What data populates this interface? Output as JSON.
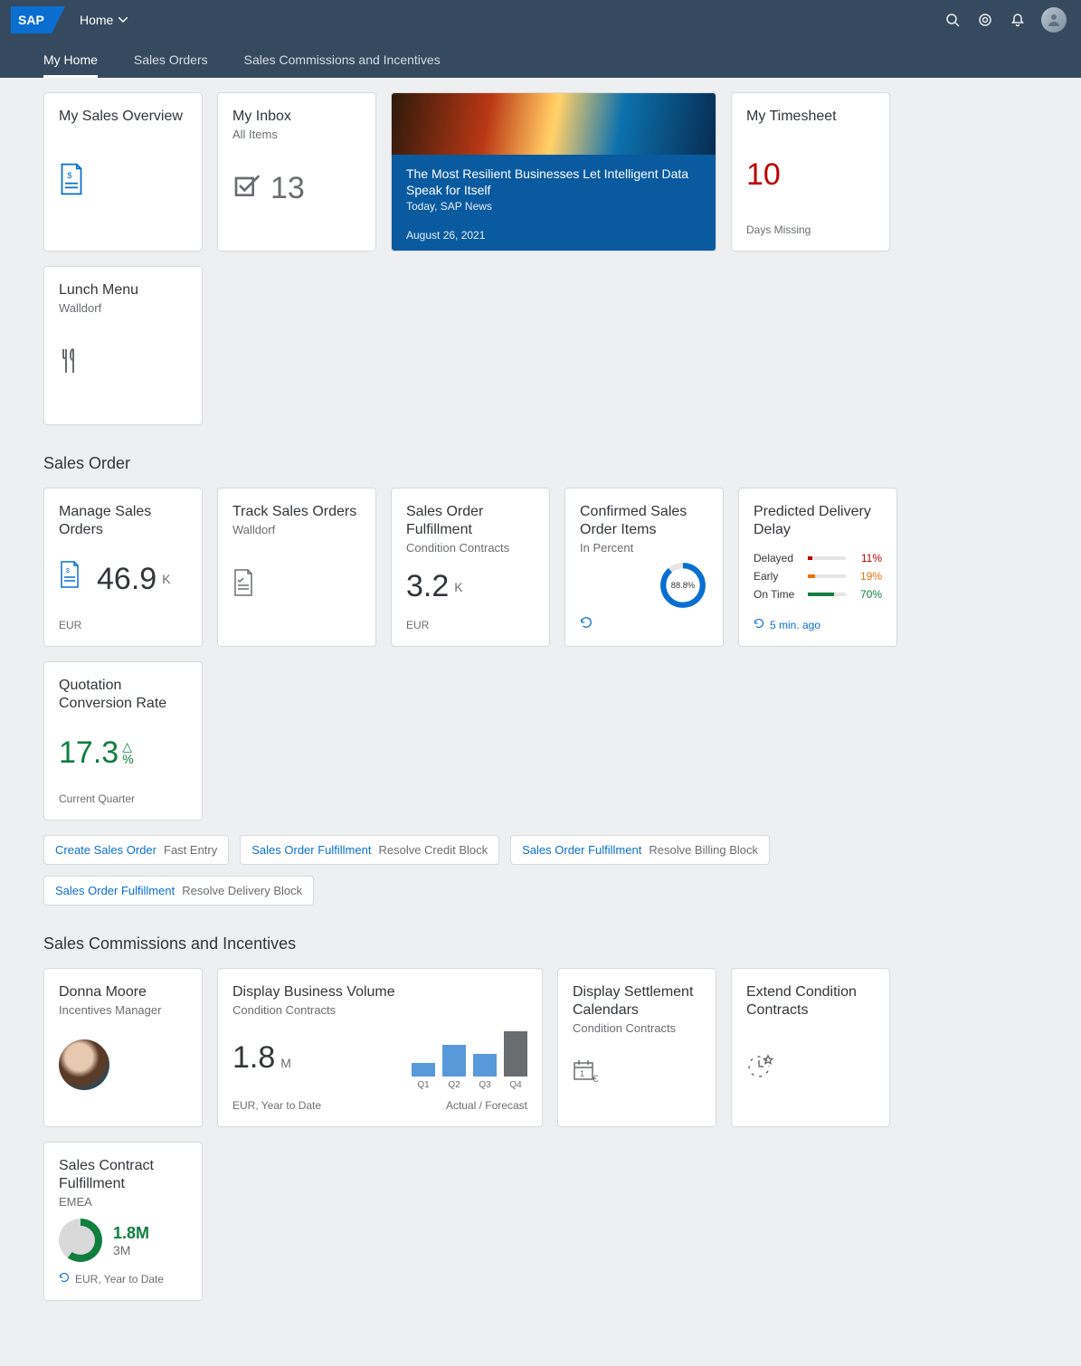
{
  "header": {
    "app_selector": "Home"
  },
  "tabs": [
    {
      "label": "My Home",
      "active": true
    },
    {
      "label": "Sales Orders",
      "active": false
    },
    {
      "label": "Sales Commissions and Incentives",
      "active": false
    }
  ],
  "top_tiles": {
    "sales_overview": {
      "title": "My Sales Overview"
    },
    "inbox": {
      "title": "My Inbox",
      "subtitle": "All Items",
      "count": "13"
    },
    "news": {
      "headline": "The Most Resilient Businesses Let Intelligent Data Speak for Itself",
      "source": "Today, SAP News",
      "date": "August 26, 2021"
    },
    "timesheet": {
      "title": "My Timesheet",
      "value": "10",
      "footer": "Days Missing"
    },
    "lunch": {
      "title": "Lunch Menu",
      "subtitle": "Walldorf"
    }
  },
  "sections": {
    "sales_order": {
      "heading": "Sales Order",
      "tiles": {
        "manage": {
          "title": "Manage Sales Orders",
          "value": "46.9",
          "unit": "K",
          "footer": "EUR"
        },
        "track": {
          "title": "Track Sales Orders",
          "subtitle": "Walldorf"
        },
        "fulfillment": {
          "title": "Sales Order Fulfillment",
          "subtitle": "Condition Contracts",
          "value": "3.2",
          "unit": "K",
          "footer": "EUR"
        },
        "confirmed": {
          "title": "Confirmed Sales Order Items",
          "subtitle": "In Percent",
          "donut": "88.8%"
        },
        "delay": {
          "title": "Predicted Delivery Delay",
          "rows": [
            {
              "label": "Delayed",
              "pct": 11,
              "color": "#bb0000",
              "val": "11%"
            },
            {
              "label": "Early",
              "pct": 19,
              "color": "#e9730c",
              "val": "19%"
            },
            {
              "label": "On Time",
              "pct": 70,
              "color": "#107e3e",
              "val": "70%"
            }
          ],
          "refresh": "5 min. ago"
        },
        "quotation": {
          "title": "Quotation Conversion Rate",
          "value": "17.3",
          "unit": "%",
          "footer": "Current Quarter"
        }
      },
      "links": [
        {
          "link": "Create Sales Order",
          "desc": "Fast Entry"
        },
        {
          "link": "Sales Order Fulfillment",
          "desc": "Resolve Credit Block"
        },
        {
          "link": "Sales Order Fulfillment",
          "desc": "Resolve Billing Block"
        },
        {
          "link": "Sales Order Fulfillment",
          "desc": "Resolve Delivery Block"
        }
      ]
    },
    "commissions": {
      "heading": "Sales Commissions and Incentives",
      "tiles": {
        "person": {
          "title": "Donna Moore",
          "subtitle": "Incentives Manager"
        },
        "volume": {
          "title": "Display Business Volume",
          "subtitle": "Condition Contracts",
          "value": "1.8",
          "unit": "M",
          "footer_left": "EUR, Year to Date",
          "footer_right": "Actual / Forecast"
        },
        "settlement": {
          "title": "Display Settlement Calendars",
          "subtitle": "Condition Contracts"
        },
        "extend": {
          "title": "Extend Condition Contracts"
        },
        "contract_fulfillment": {
          "title": "Sales Contract Fulfillment",
          "subtitle": "EMEA",
          "primary": "1.8M",
          "secondary": "3M",
          "footer": "EUR, Year to Date"
        }
      }
    }
  },
  "chart_data": {
    "type": "bar",
    "title": "Display Business Volume",
    "categories": [
      "Q1",
      "Q2",
      "Q3",
      "Q4"
    ],
    "series": [
      {
        "name": "Actual",
        "values": [
          15,
          35,
          25,
          null
        ]
      },
      {
        "name": "Forecast",
        "values": [
          null,
          null,
          null,
          50
        ]
      }
    ],
    "note": "Values are relative bar heights (unitless, approx 0–50). Q4 is forecast (grey).",
    "footer": "Actual / Forecast"
  }
}
